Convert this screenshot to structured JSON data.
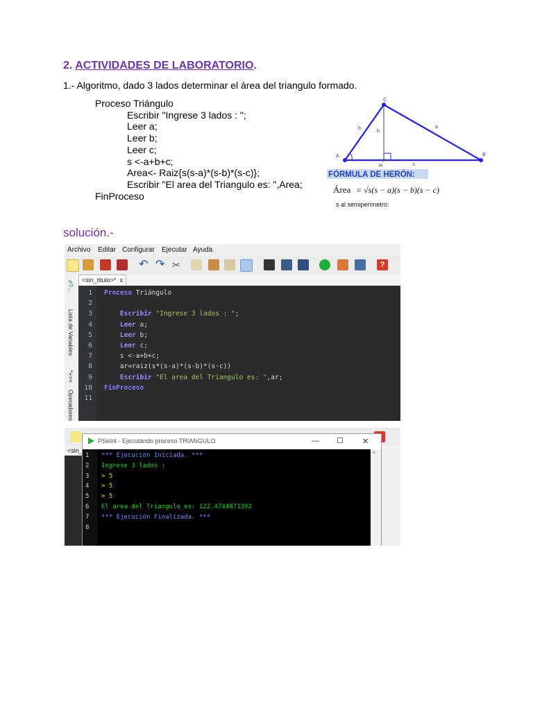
{
  "heading": {
    "number": "2. ",
    "text": "ACTIVIDADES DE LABORATORIO",
    "end": "."
  },
  "intro": "1.-  Algoritmo, dado 3 lados determinar el área del triangulo formado.",
  "pseudocode": [
    "Proceso Triángulo",
    "Escribir \"Ingrese 3 lados : \";",
    "Leer a;",
    "Leer b;",
    "Leer c;",
    "s <-a+b+c;",
    "Area<- Raiz{s(s-a)*(s-b)*(s-c)};",
    "Escribir \"El area del Triangulo es: \",Area;",
    "FinProceso"
  ],
  "diagram": {
    "vertices": {
      "a": "A",
      "b": "B",
      "c": "C",
      "h": "H"
    },
    "sides": {
      "a": "a",
      "b": "b",
      "c": "c",
      "h": "h"
    },
    "heron_title": "FÓRMULA DE HERÓN:",
    "area_label": "Área",
    "formula": "= √s(s − a)(s − b)(s − c)",
    "semi": "s  al semiperímetro:"
  },
  "solucion": "solución.-",
  "ide": {
    "menu": [
      "Archivo",
      "Editar",
      "Configurar",
      "Ejecutar",
      "Ayuda"
    ],
    "tab": "<sin_titulo>*",
    "tab_close": "x",
    "side_labels": [
      "Lista de Variables",
      "Operadores"
    ],
    "side_symbols": "*+=<",
    "line_numbers": [
      "1",
      "2",
      "3",
      "4",
      "5",
      "6",
      "7",
      "8",
      "9",
      "10",
      "11"
    ],
    "code": [
      [
        {
          "t": "Proceso ",
          "c": "kw"
        },
        {
          "t": "Triángulo",
          "c": ""
        }
      ],
      [],
      [
        {
          "t": "    Escribir ",
          "c": "kw2"
        },
        {
          "t": "\"Ingrese 3 lados : \"",
          "c": "str"
        },
        {
          "t": ";",
          "c": ""
        }
      ],
      [
        {
          "t": "    Leer ",
          "c": "kw2"
        },
        {
          "t": "a;",
          "c": ""
        }
      ],
      [
        {
          "t": "    Leer ",
          "c": "kw2"
        },
        {
          "t": "b;",
          "c": ""
        }
      ],
      [
        {
          "t": "    Leer ",
          "c": "kw2"
        },
        {
          "t": "c;",
          "c": ""
        }
      ],
      [
        {
          "t": "    s <-a+b+c;",
          "c": ""
        }
      ],
      [
        {
          "t": "    ar=raiz(s*(s-a)*(s-b)*(s-c))",
          "c": ""
        }
      ],
      [
        {
          "t": "    Escribir ",
          "c": "kw2"
        },
        {
          "t": "\"El area del Triangulo es: \"",
          "c": "str"
        },
        {
          "t": ",ar;",
          "c": ""
        }
      ],
      [
        {
          "t": "FinProceso",
          "c": "kw"
        }
      ],
      []
    ]
  },
  "console": {
    "tab_fragment": "<sin_",
    "window_title": "PSeInt - Ejecutando proceso TRIANGULO",
    "controls": [
      "—",
      "☐",
      "✕"
    ],
    "line_numbers": [
      "1",
      "2",
      "3",
      "4",
      "5",
      "6",
      "7",
      "8"
    ],
    "lines": [
      {
        "t": "*** Ejecución Iniciada. ***",
        "c": "b"
      },
      {
        "t": "Ingrese 3 lados :",
        "c": "g"
      },
      {
        "t": "> 5",
        "c": "y"
      },
      {
        "t": "> 5",
        "c": "y"
      },
      {
        "t": "> 5",
        "c": "y"
      },
      {
        "t": "El area del Triangulo es: 122.4744871392",
        "c": "g"
      },
      {
        "t": "*** Ejecución Finalizada. ***",
        "c": "b"
      },
      {
        "t": "",
        "c": ""
      },
      {
        "t": "",
        "c": ""
      }
    ]
  }
}
